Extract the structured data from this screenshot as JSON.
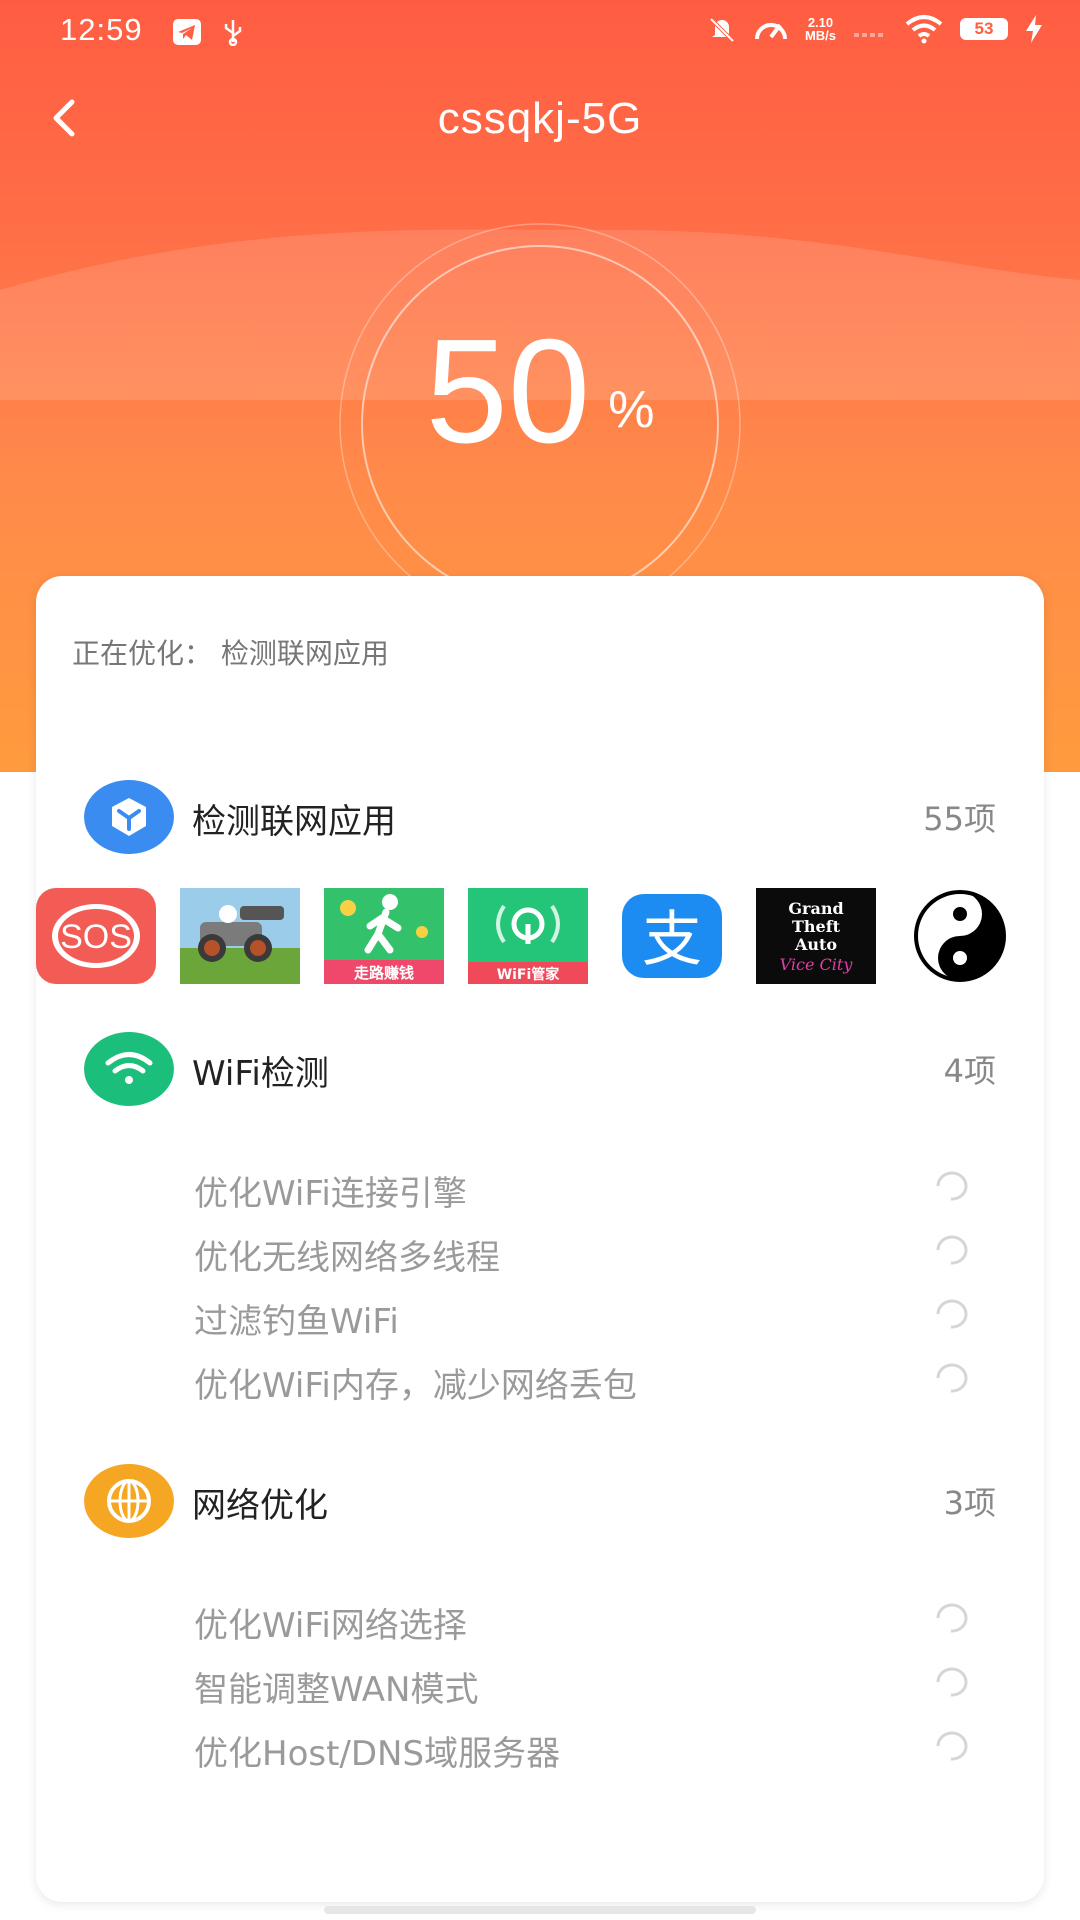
{
  "status_bar": {
    "time": "12:59",
    "speed_value": "2.10",
    "speed_unit": "MB/s",
    "battery": "53",
    "left_icons": [
      "telegram-icon",
      "usb-icon"
    ],
    "right_icons": [
      "bell-off-icon",
      "speedometer-icon",
      "signal-icon",
      "wifi-icon",
      "battery-icon",
      "charging-icon"
    ]
  },
  "header": {
    "title": "cssqkj-5G"
  },
  "progress": {
    "value": "50",
    "unit": "%"
  },
  "optimizing": {
    "text": "正在优化：  检测联网应用"
  },
  "sections": {
    "apps": {
      "title": "检测联网应用",
      "count": "55项",
      "icon": "network-cube-icon",
      "color": "#3A8CF0"
    },
    "wifi": {
      "title": "WiFi检测",
      "count": "4项",
      "icon": "wifi-icon",
      "color": "#1BBE7A",
      "items": [
        "优化WiFi连接引擎",
        "优化无线网络多线程",
        "过滤钓鱼WiFi",
        "优化WiFi内存，减少网络丢包"
      ]
    },
    "network": {
      "title": "网络优化",
      "count": "3项",
      "icon": "network-globe-icon",
      "color": "#F5A623",
      "items": [
        "优化WiFi网络选择",
        "智能调整WAN模式",
        "优化Host/DNS域服务器"
      ]
    }
  },
  "apps": [
    {
      "icon": "sos-app-icon",
      "label": "SOS"
    },
    {
      "icon": "hill-climb-game-icon",
      "label": ""
    },
    {
      "icon": "walk-earn-app-icon",
      "label": "走路赚钱"
    },
    {
      "icon": "wifi-manager-app-icon",
      "label": "WiFi管家"
    },
    {
      "icon": "alipay-app-icon",
      "label": "支"
    },
    {
      "icon": "gta-vice-city-app-icon",
      "label": "Grand Theft Auto"
    },
    {
      "icon": "yin-yang-app-icon",
      "label": ""
    }
  ],
  "colors": {
    "hero_top": "#FF5D42",
    "hero_bottom": "#FF9B3E",
    "item_text": "#9a9a9a"
  }
}
